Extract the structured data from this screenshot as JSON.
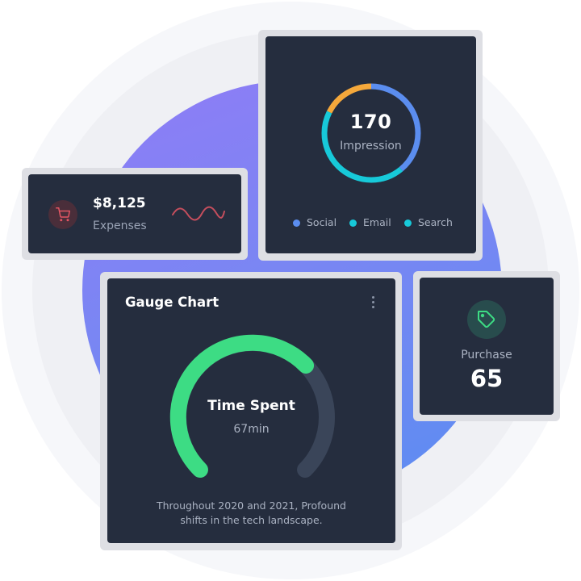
{
  "colors": {
    "card_bg": "#252d3e",
    "social": "#5b8def",
    "email": "#17c9d9",
    "search": "#17c9d9",
    "orange": "#f5a83b",
    "gauge_fill": "#3ddc84",
    "gauge_track": "#3a4559",
    "expense_red": "#e25563",
    "purchase_green": "#3ddc84",
    "blob_purple": "#8f7cf6",
    "blob_blue": "#5a8df2"
  },
  "impression": {
    "value": "170",
    "label": "Impression",
    "legend": [
      {
        "label": "Social",
        "color": "#5b8def"
      },
      {
        "label": "Email",
        "color": "#17c9d9"
      },
      {
        "label": "Search",
        "color": "#17c9d9"
      }
    ]
  },
  "expenses": {
    "value": "$8,125",
    "label": "Expenses",
    "icon": "shopping-cart-icon"
  },
  "gauge": {
    "title": "Gauge Chart",
    "label": "Time Spent",
    "value": "67min",
    "fill_fraction": 0.67,
    "description_line1": "Throughout 2020 and 2021, Profound",
    "description_line2": "shifts in the tech landscape.",
    "menu_icon": "kebab-menu-icon"
  },
  "purchase": {
    "label": "Purchase",
    "value": "65",
    "icon": "price-tag-icon"
  }
}
